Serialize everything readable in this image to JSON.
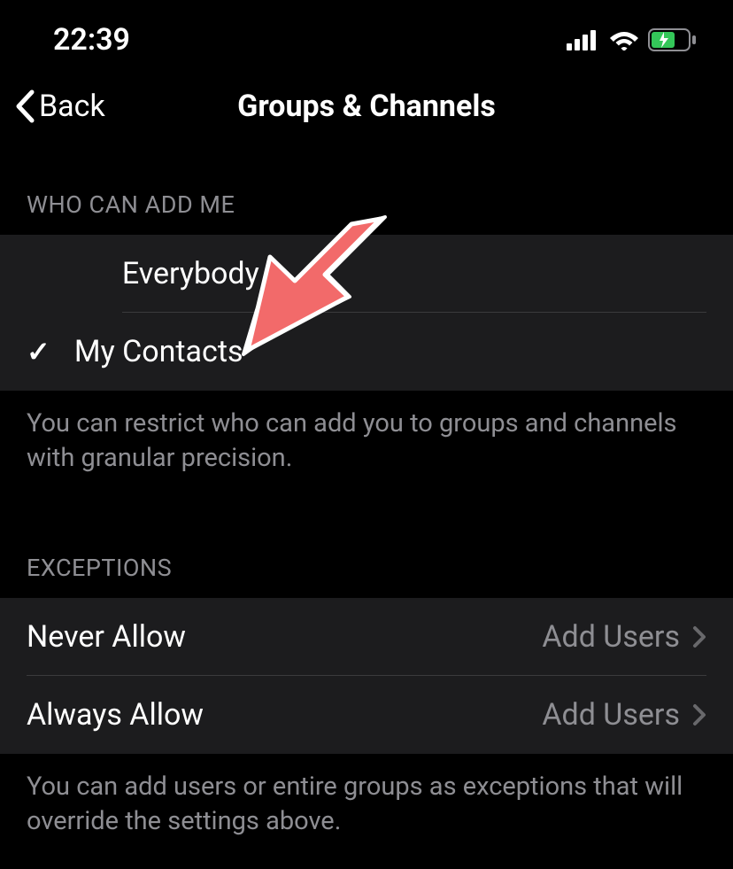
{
  "statusBar": {
    "time": "22:39"
  },
  "nav": {
    "backLabel": "Back",
    "title": "Groups & Channels"
  },
  "sections": {
    "whoCanAdd": {
      "header": "WHO CAN ADD ME",
      "options": [
        {
          "label": "Everybody",
          "selected": false
        },
        {
          "label": "My Contacts",
          "selected": true
        }
      ],
      "footer": "You can restrict who can add you to groups and channels with granular precision."
    },
    "exceptions": {
      "header": "EXCEPTIONS",
      "items": [
        {
          "label": "Never Allow",
          "value": "Add Users"
        },
        {
          "label": "Always Allow",
          "value": "Add Users"
        }
      ],
      "footer": "You can add users or entire groups as exceptions that will override the settings above."
    }
  }
}
